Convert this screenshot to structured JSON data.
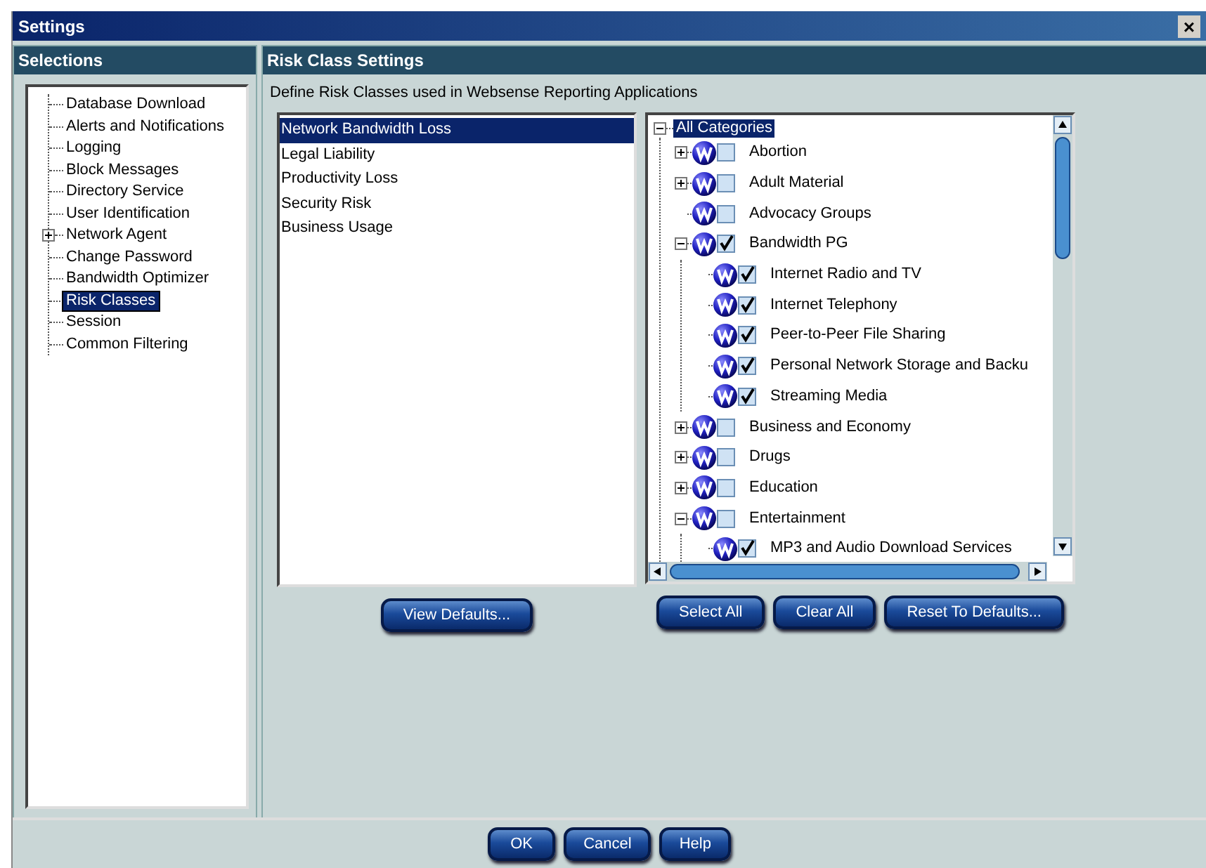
{
  "window": {
    "title": "Settings",
    "close": "×"
  },
  "selections": {
    "title": "Selections",
    "items": [
      {
        "label": "Database Download",
        "selected": false
      },
      {
        "label": "Alerts and Notifications",
        "selected": false
      },
      {
        "label": "Logging",
        "selected": false
      },
      {
        "label": "Block Messages",
        "selected": false
      },
      {
        "label": "Directory Service",
        "selected": false
      },
      {
        "label": "User Identification",
        "selected": false
      },
      {
        "label": "Network Agent",
        "selected": false,
        "expanded": false
      },
      {
        "label": "Change Password",
        "selected": false
      },
      {
        "label": "Bandwidth Optimizer",
        "selected": false
      },
      {
        "label": "Risk Classes",
        "selected": true
      },
      {
        "label": "Session",
        "selected": false
      },
      {
        "label": "Common Filtering",
        "selected": false
      }
    ]
  },
  "risk_class_settings": {
    "title": "Risk Class Settings",
    "description": "Define Risk Classes used in Websense Reporting Applications",
    "risk_classes": [
      {
        "label": "Network Bandwidth Loss",
        "selected": true
      },
      {
        "label": "Legal Liability",
        "selected": false
      },
      {
        "label": "Productivity Loss",
        "selected": false
      },
      {
        "label": "Security Risk",
        "selected": false
      },
      {
        "label": "Business Usage",
        "selected": false
      }
    ],
    "category_tree": {
      "label": "All Categories",
      "selected": true,
      "expanded": true,
      "children": [
        {
          "label": "Abortion",
          "checked": false,
          "expanded": false
        },
        {
          "label": "Adult Material",
          "checked": false,
          "expanded": false
        },
        {
          "label": "Advocacy Groups",
          "checked": false
        },
        {
          "label": "Bandwidth PG",
          "checked": true,
          "expanded": true,
          "children": [
            {
              "label": "Internet Radio and TV",
              "checked": true
            },
            {
              "label": "Internet Telephony",
              "checked": true
            },
            {
              "label": "Peer-to-Peer File Sharing",
              "checked": true
            },
            {
              "label": "Personal Network Storage and Backu",
              "checked": true
            },
            {
              "label": "Streaming Media",
              "checked": true
            }
          ]
        },
        {
          "label": "Business and Economy",
          "checked": false,
          "expanded": false
        },
        {
          "label": "Drugs",
          "checked": false,
          "expanded": false
        },
        {
          "label": "Education",
          "checked": false,
          "expanded": false
        },
        {
          "label": "Entertainment",
          "checked": false,
          "expanded": true,
          "children": [
            {
              "label": "MP3 and Audio Download Services",
              "checked": true
            }
          ]
        }
      ]
    },
    "list_buttons": [
      "View Defaults..."
    ],
    "tree_buttons": [
      "Select All",
      "Clear All",
      "Reset To Defaults..."
    ]
  },
  "footer_buttons": [
    "OK",
    "Cancel",
    "Help"
  ]
}
